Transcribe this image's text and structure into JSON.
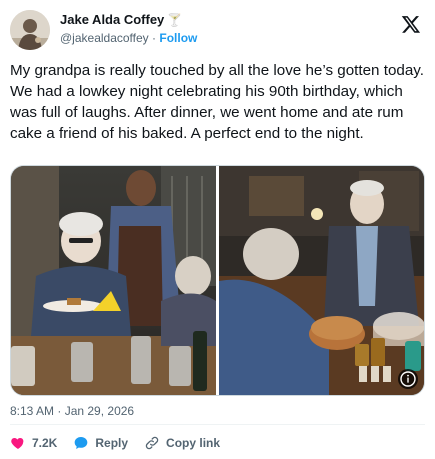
{
  "author": {
    "display_name": "Jake Alda Coffey",
    "name_emoji": "🍸",
    "handle": "@jakealdacoffey",
    "separator": "·",
    "follow_label": "Follow"
  },
  "tweet": {
    "text": "My grandpa is really touched by all the love he’s gotten today. We had a lowkey night celebrating his 90th birthday, which was full of laughs. After dinner, we went home and ate rum cake a friend of his baked. A perfect end to the night.",
    "timestamp": "8:13 AM · Jan 29, 2026"
  },
  "actions": {
    "likes_count": "7.2K",
    "reply_label": "Reply",
    "copy_link_label": "Copy link"
  },
  "icons": {
    "brand": "x-logo-icon",
    "like": "heart-icon",
    "reply": "speech-bubble-icon",
    "copy": "link-icon",
    "info": "info-icon"
  },
  "colors": {
    "accent": "#1d9bf0",
    "like": "#f91880",
    "secondary_text": "#536471",
    "border": "#cfd9de"
  }
}
